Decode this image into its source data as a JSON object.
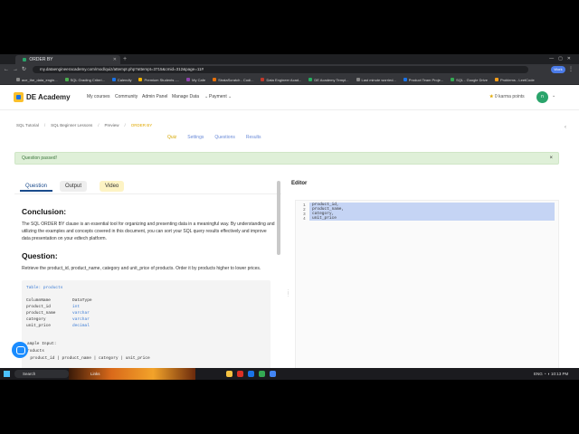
{
  "browser": {
    "tab_title": "ORDER BY",
    "url": "my.dataengineeracademy.com/mod/quiz/attempt.php?attempt=3715&cmid=312&page=11#",
    "work_label": "Work",
    "bookmarks": [
      "ace_the_data_engin...",
      "SQL Grading Criteri...",
      "Calendly",
      "Premium Students -...",
      "My Cafe",
      "StrataScratch - Codi...",
      "Data Engineer Acad...",
      "DE Academy Templ...",
      "Last minute worried...",
      "Product Team Proje...",
      "SQL - Google Drive",
      "Problems - LeetCode"
    ]
  },
  "site": {
    "logo": "DE Academy",
    "nav": [
      "My courses",
      "Community",
      "Admin Panel",
      "Manage Data",
      "Payment"
    ],
    "karma_value": "0",
    "karma_label": "karma points",
    "avatar": "n"
  },
  "breadcrumb": [
    "SQL Tutorial",
    "SQL Beginner Lessons",
    "Preview",
    "ORDER BY"
  ],
  "quiz_tabs": [
    "Quiz",
    "Settings",
    "Questions",
    "Results"
  ],
  "alert": {
    "text": "Question passed!",
    "close": "×"
  },
  "panel_tabs": {
    "question": "Question",
    "output": "Output",
    "video": "Video"
  },
  "conclusion": {
    "heading": "Conclusion:",
    "text": "The SQL ORDER BY clause is an essential tool for organizing and presenting data in a meaningful way. By understanding and utilizing the examples and concepts covered in this document, you can sort your SQL query results effectively and improve data presentation on your edtech platform."
  },
  "question": {
    "heading": "Question:",
    "text": "Retrieve the product_id, product_name, category and unit_price of products. Order it by products higher to lower prices."
  },
  "table_info": {
    "label": "Table: products",
    "col_header": "ColumnName",
    "type_header": "DataType",
    "rows": [
      {
        "name": "product_id",
        "type": "int"
      },
      {
        "name": "product_name",
        "type": "varchar"
      },
      {
        "name": "category",
        "type": "varchar"
      },
      {
        "name": "unit_price",
        "type": "decimal"
      }
    ],
    "sample_input": "ample Input:",
    "sample_table": "roducts",
    "sample_header": "  product_id | product_name | category | unit_price"
  },
  "editor": {
    "label": "Editor",
    "line_numbers": [
      "1",
      "2",
      "3",
      "4"
    ],
    "lines": [
      "product_id,",
      "product_name,",
      "category,",
      "unit_price"
    ]
  },
  "taskbar": {
    "search": "Search",
    "links": "Links",
    "lang": "ENG",
    "time": "10:13 PM"
  }
}
